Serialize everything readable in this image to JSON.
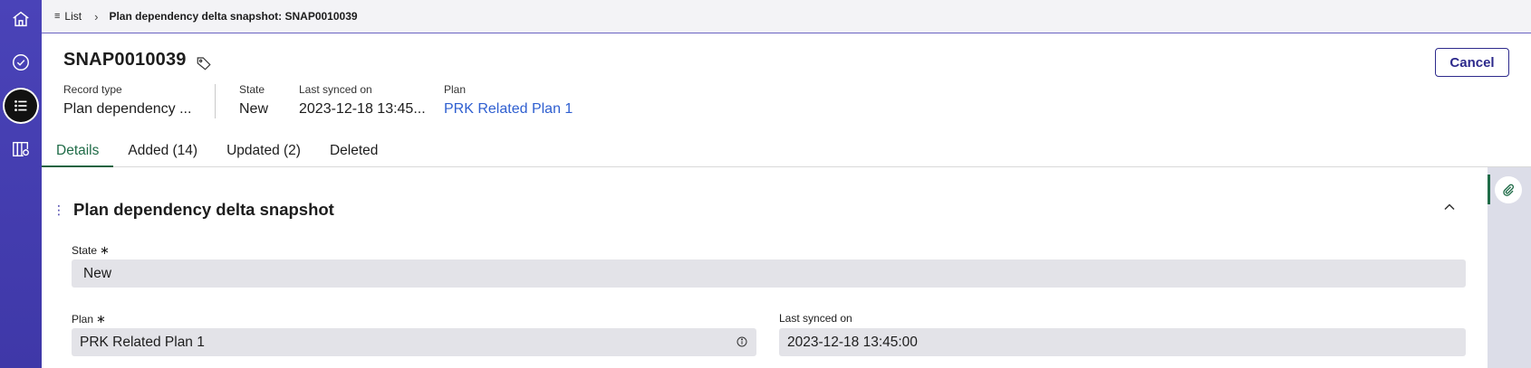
{
  "nav": {
    "items": [
      {
        "name": "home",
        "icon": "home-icon"
      },
      {
        "name": "approvals",
        "icon": "check-circle-icon"
      },
      {
        "name": "list",
        "icon": "list-icon",
        "active": true
      },
      {
        "name": "map",
        "icon": "map-icon"
      }
    ]
  },
  "breadcrumb": {
    "list_label": "List",
    "current": "Plan dependency delta snapshot: SNAP0010039"
  },
  "header": {
    "title": "SNAP0010039",
    "cancel_label": "Cancel",
    "meta": [
      {
        "label": "Record type",
        "value": "Plan dependency ..."
      },
      {
        "label": "State",
        "value": "New"
      },
      {
        "label": "Last synced on",
        "value": "2023-12-18 13:45..."
      },
      {
        "label": "Plan",
        "value": "PRK Related Plan 1"
      }
    ]
  },
  "tabs": [
    {
      "label": "Details",
      "active": true
    },
    {
      "label": "Added (14)"
    },
    {
      "label": "Updated (2)"
    },
    {
      "label": "Deleted"
    }
  ],
  "section": {
    "title": "Plan dependency delta snapshot",
    "fields": {
      "state": {
        "label": "State",
        "required_mark": "∗",
        "value": "New"
      },
      "plan": {
        "label": "Plan",
        "required_mark": "∗",
        "value": "PRK Related Plan 1"
      },
      "last_synced": {
        "label": "Last synced on",
        "value": "2023-12-18 13:45:00"
      }
    }
  },
  "colors": {
    "rail": "#4a43b8",
    "accent_green": "#1f6b47",
    "link_blue": "#2f5fd0",
    "button_navy": "#2d2a8c"
  }
}
